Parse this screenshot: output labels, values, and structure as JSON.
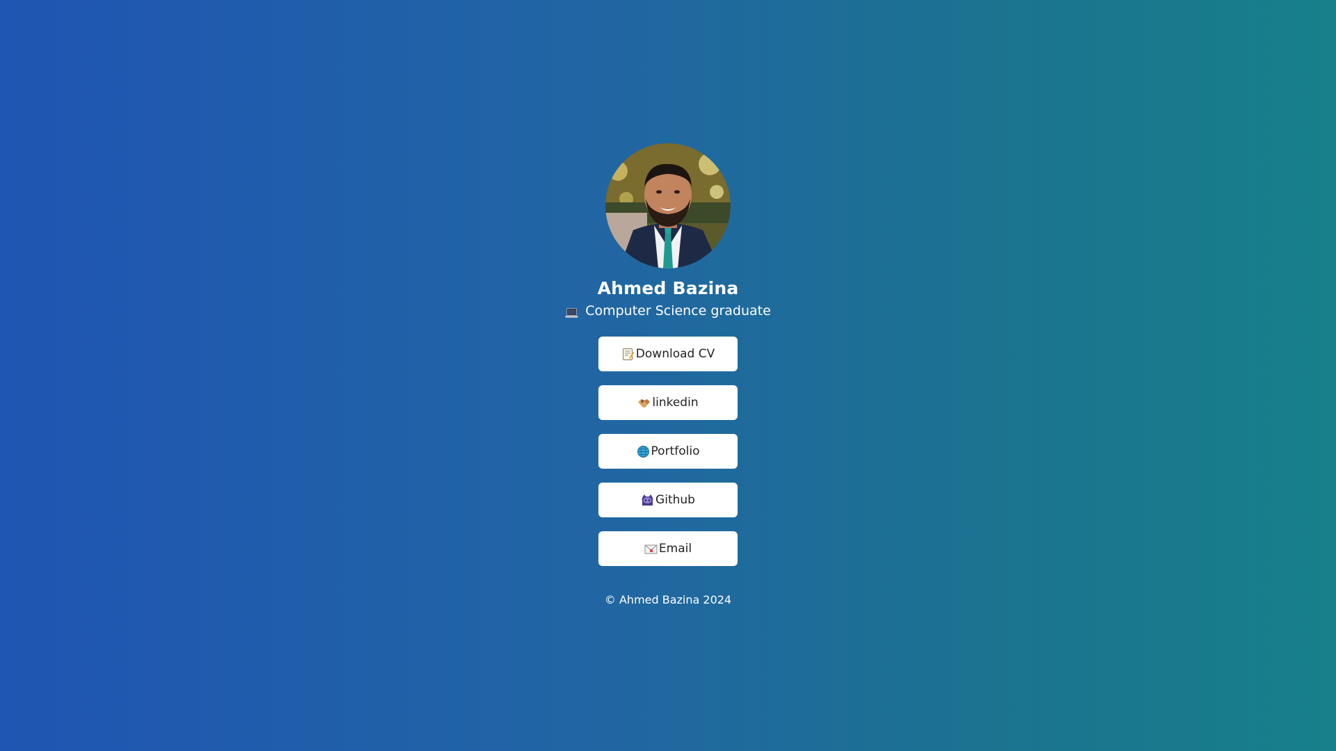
{
  "profile": {
    "name": "Ahmed Bazina",
    "subtitle": "Computer Science graduate",
    "subtitle_icon": "laptop-icon",
    "avatar_icon": "profile-photo"
  },
  "links": [
    {
      "label": "Download CV",
      "icon": "memo-icon"
    },
    {
      "label": "linkedin",
      "icon": "handshake-icon"
    },
    {
      "label": "Portfolio",
      "icon": "globe-icon"
    },
    {
      "label": "Github",
      "icon": "octocat-icon"
    },
    {
      "label": "Email",
      "icon": "envelope-icon"
    }
  ],
  "footer": {
    "text": "© Ahmed Bazina 2024"
  },
  "colors": {
    "background_start": "#1f55b3",
    "background_end": "#17808a",
    "button_bg": "#ffffff",
    "button_text": "#222222"
  }
}
